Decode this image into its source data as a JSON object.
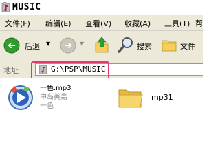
{
  "window": {
    "title": "MUSIC"
  },
  "menu": {
    "items": [
      {
        "label": "文件(F)"
      },
      {
        "label": "编辑(E)"
      },
      {
        "label": "查看(V)"
      },
      {
        "label": "收藏(A)"
      },
      {
        "label": "工具(T)"
      },
      {
        "label": "帮"
      }
    ]
  },
  "toolbar": {
    "back_label": "后退",
    "search_label": "搜索",
    "folders_label": "文件"
  },
  "address": {
    "label": "地址",
    "value": "G:\\PSP\\MUSIC"
  },
  "files": [
    {
      "name": "一色.mp3",
      "meta_line1": "中岛美嘉",
      "meta_line2": "一色",
      "icon": "windows-media-audio-icon"
    },
    {
      "name": "mp31",
      "icon": "folder-icon"
    }
  ],
  "colors": {
    "highlight": "#e2396f",
    "chrome": "#ece9d8",
    "back_arrow": "#2e9d2e",
    "folder": "#f4cf5a"
  }
}
